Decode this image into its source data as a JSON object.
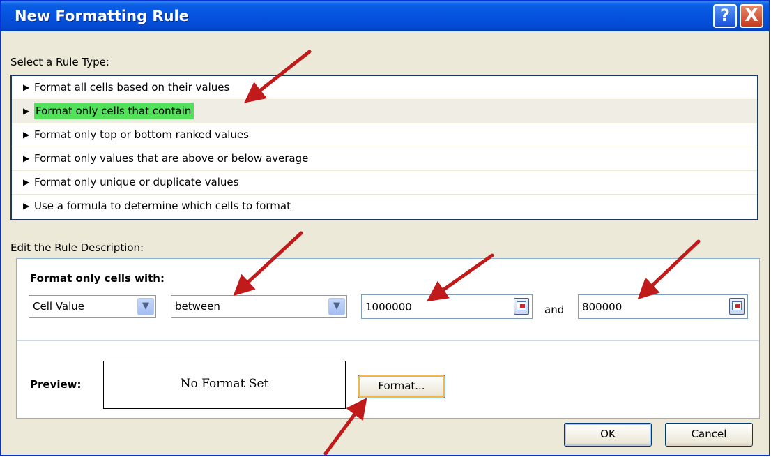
{
  "window": {
    "title": "New Formatting Rule"
  },
  "titlebar_buttons": {
    "help": "?",
    "close": "X"
  },
  "select_rule_type": {
    "label": "Select a Rule Type:",
    "items": [
      "Format all cells based on their values",
      "Format only cells that contain",
      "Format only top or bottom ranked values",
      "Format only values that are above or below average",
      "Format only unique or duplicate values",
      "Use a formula to determine which cells to format"
    ],
    "selected_index": 1
  },
  "edit_rule": {
    "label": "Edit the Rule Description:",
    "header": "Format only cells with:",
    "condition_type": "Cell Value",
    "operator": "between",
    "value1": "1000000",
    "and_label": "and",
    "value2": "800000",
    "preview_label": "Preview:",
    "preview_text": "No Format Set",
    "format_button": "Format..."
  },
  "buttons": {
    "ok": "OK",
    "cancel": "Cancel"
  },
  "annotation_color": "#c01a1a",
  "highlight_color": "#53e05a"
}
